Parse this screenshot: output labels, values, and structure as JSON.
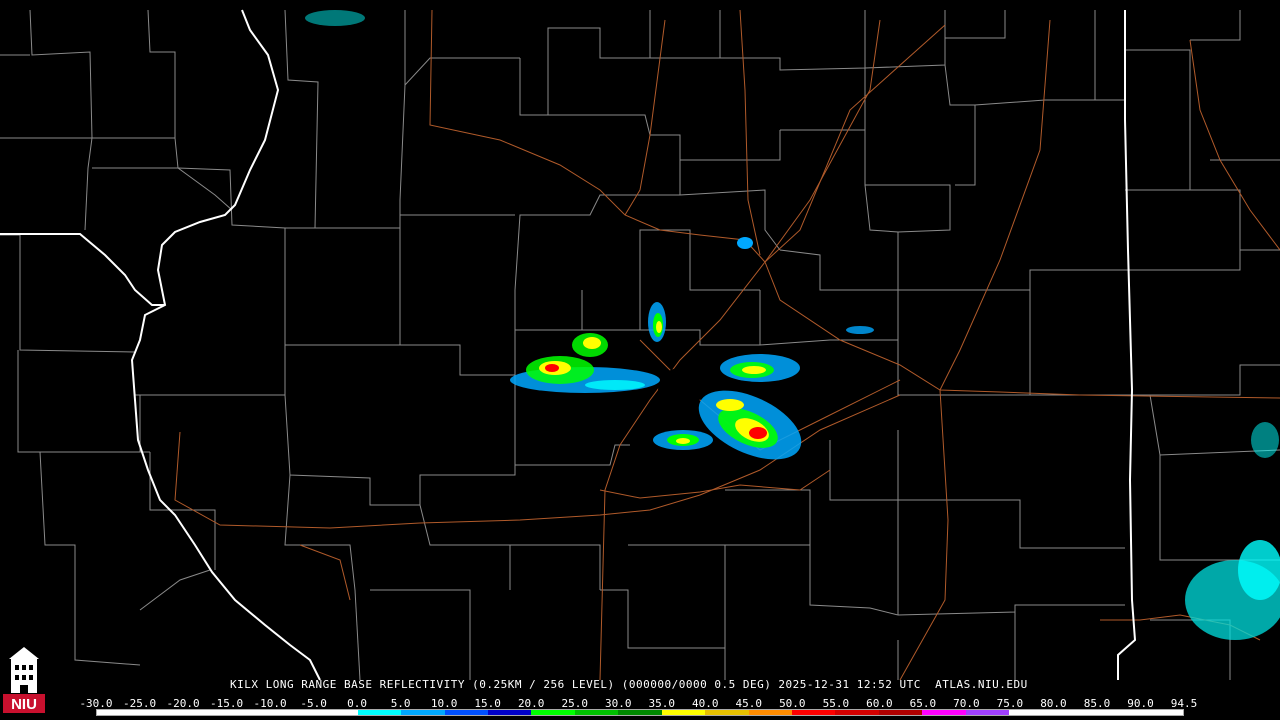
{
  "product": {
    "title": "KILX LONG RANGE BASE REFLECTIVITY (0.25KM / 256 LEVEL) (000000/0000 0.5 DEG) 2025-12-31 12:52 UTC  ATLAS.NIU.EDU"
  },
  "logo": {
    "text": "NIU",
    "icon": "university-tower-icon",
    "color": "#c8102e"
  },
  "colors": {
    "background": "#000000",
    "county_lines": "#8a8a8a",
    "state_lines": "#ffffff",
    "highways": "#b05a2a"
  },
  "color_scale": {
    "labels": [
      "-30.0",
      "-25.0",
      "-20.0",
      "-15.0",
      "-10.0",
      "-5.0",
      "0.0",
      "5.0",
      "10.0",
      "15.0",
      "20.0",
      "25.0",
      "30.0",
      "35.0",
      "40.0",
      "45.0",
      "50.0",
      "55.0",
      "60.0",
      "65.0",
      "70.0",
      "75.0",
      "80.0",
      "85.0",
      "90.0",
      "94.5"
    ],
    "colors": [
      "#ffffff",
      "#ffffff",
      "#ffffff",
      "#ffffff",
      "#ffffff",
      "#ffffff",
      "#00ffff",
      "#00a8ff",
      "#0050ff",
      "#0000c8",
      "#00ff00",
      "#00c000",
      "#008800",
      "#ffff00",
      "#e6c000",
      "#ff8c00",
      "#ff0000",
      "#d40000",
      "#b00000",
      "#ff00ff",
      "#a040ff",
      "#ffffff",
      "#ffffff",
      "#ffffff",
      "#ffffff"
    ]
  }
}
